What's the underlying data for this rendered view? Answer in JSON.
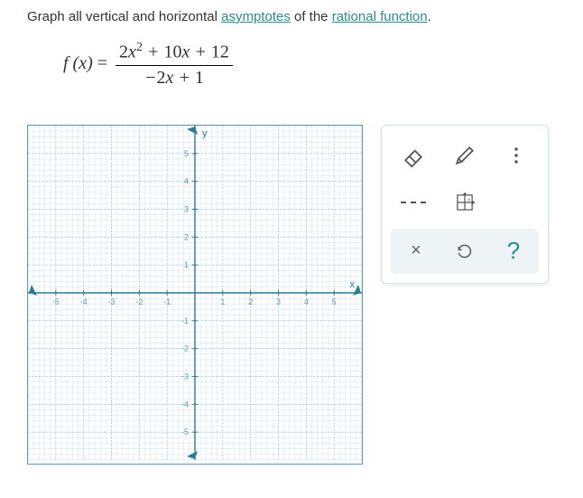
{
  "prompt": {
    "pre": "Graph all vertical and horizontal ",
    "link1": "asymptotes",
    "mid": " of the ",
    "link2": "rational function",
    "post": "."
  },
  "formula": {
    "lhs": "f (x)",
    "eq": "=",
    "numerator": "2x² + 10x + 12",
    "denominator": "−2x + 1"
  },
  "chart_data": {
    "type": "scatter",
    "title": "",
    "xlabel": "x",
    "ylabel": "y",
    "xlim": [
      -6,
      6
    ],
    "ylim": [
      -6,
      6
    ],
    "xticks": [
      -5,
      -4,
      -3,
      -2,
      -1,
      1,
      2,
      3,
      4,
      5
    ],
    "yticks": [
      -5,
      -4,
      -3,
      -2,
      -1,
      1,
      2,
      3,
      4,
      5
    ],
    "major_grid": 1,
    "minor_grid": 0.2,
    "series": []
  },
  "tools": {
    "eraser": "eraser-tool",
    "pencil": "pencil-tool",
    "more": "more-tool",
    "dashed": "dashed-line-tool",
    "axis_drag": "axis-drag-tool",
    "clear": "×",
    "undo": "↺",
    "help": "?"
  }
}
